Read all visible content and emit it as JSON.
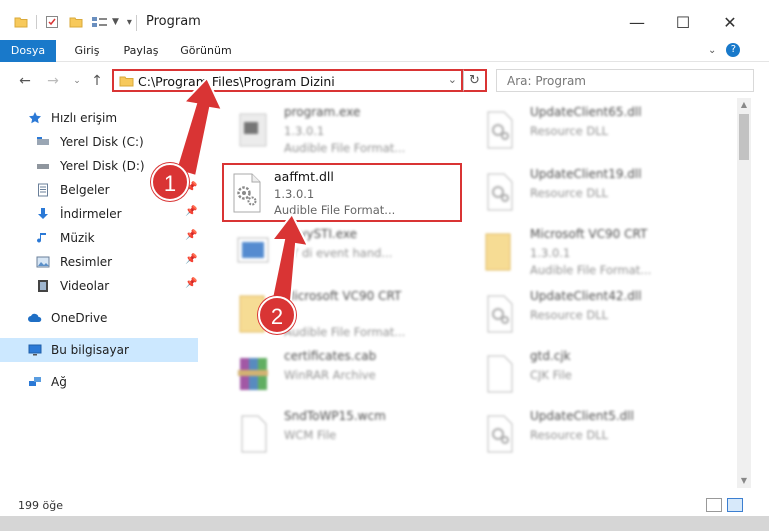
{
  "window": {
    "title": "Program",
    "controls": {
      "minimize": "—",
      "maximize": "☐",
      "close": "✕"
    }
  },
  "ribbon": {
    "tabs": [
      "Dosya",
      "Giriş",
      "Paylaş",
      "Görünüm"
    ],
    "file_tab_color": "#1979ca"
  },
  "address": {
    "path": "C:\\Program Files\\Program Dizini",
    "search_placeholder": "Ara: Program"
  },
  "nav": {
    "quick_access": "Hızlı erişim",
    "items": [
      {
        "label": "Yerel Disk (C:)",
        "icon": "drive-icon"
      },
      {
        "label": "Yerel Disk (D:)",
        "icon": "drive-icon"
      },
      {
        "label": "Belgeler",
        "icon": "documents-icon"
      },
      {
        "label": "İndirmeler",
        "icon": "downloads-icon"
      },
      {
        "label": "Müzik",
        "icon": "music-icon"
      },
      {
        "label": "Resimler",
        "icon": "pictures-icon"
      },
      {
        "label": "Videolar",
        "icon": "videos-icon"
      }
    ],
    "onedrive": "OneDrive",
    "this_pc": "Bu bilgisayar",
    "network": "Ağ"
  },
  "files": {
    "highlighted": {
      "name": "aaffmt.dll",
      "version": "1.3.0.1",
      "type": "Audible File Format..."
    },
    "left": [
      {
        "name": "program.exe",
        "l2": "1.3.0.1",
        "l3": "Audible File Format..."
      },
      {
        "name": "",
        "l2": "",
        "l3": ""
      },
      {
        "name": "bbyySTI.exe",
        "l2": "BY di event hand...",
        "l3": ""
      },
      {
        "name": "Microsoft VC90 CRT",
        "l2": "",
        "l3": "Audible File Format..."
      },
      {
        "name": "certificates.cab",
        "l2": "WinRAR Archive",
        "l3": ""
      },
      {
        "name": "SndToWP15.wcm",
        "l2": "WCM File",
        "l3": ""
      }
    ],
    "right": [
      {
        "name": "UpdateClient65.dll",
        "l2": "Resource DLL",
        "l3": ""
      },
      {
        "name": "UpdateClient19.dll",
        "l2": "Resource DLL",
        "l3": ""
      },
      {
        "name": "Microsoft VC90 CRT",
        "l2": "1.3.0.1",
        "l3": "Audible File Format..."
      },
      {
        "name": "UpdateClient42.dll",
        "l2": "Resource DLL",
        "l3": ""
      },
      {
        "name": "gtd.cjk",
        "l2": "CJK File",
        "l3": ""
      },
      {
        "name": "UpdateClient5.dll",
        "l2": "Resource DLL",
        "l3": ""
      }
    ]
  },
  "status": {
    "count": "199 öğe"
  },
  "annotations": {
    "step1": "1",
    "step2": "2",
    "color": "#d93434"
  }
}
